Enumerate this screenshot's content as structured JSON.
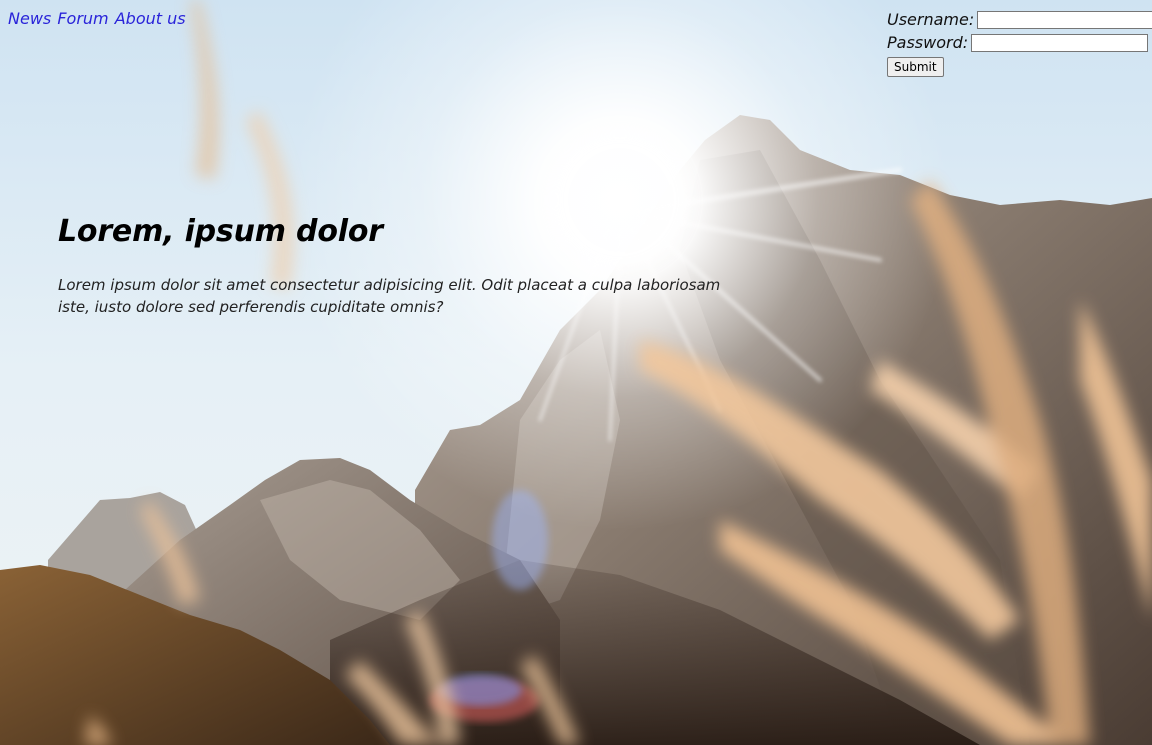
{
  "nav": {
    "links": [
      "News",
      "Forum",
      "About us"
    ]
  },
  "login": {
    "username_label": "Username:",
    "password_label": "Password:",
    "username_value": "",
    "password_value": "",
    "submit_label": "Submit"
  },
  "hero": {
    "title": "Lorem, ipsum dolor",
    "body": "Lorem ipsum dolor sit amet consectetur adipisicing elit. Odit placeat a culpa laboriosam iste, iusto dolore sed perferendis cupiditate omnis?"
  },
  "colors": {
    "link": "#2a24d9",
    "sky": "#dbeaf4",
    "rock": "#7c6e62",
    "grass": "#e8b887"
  }
}
